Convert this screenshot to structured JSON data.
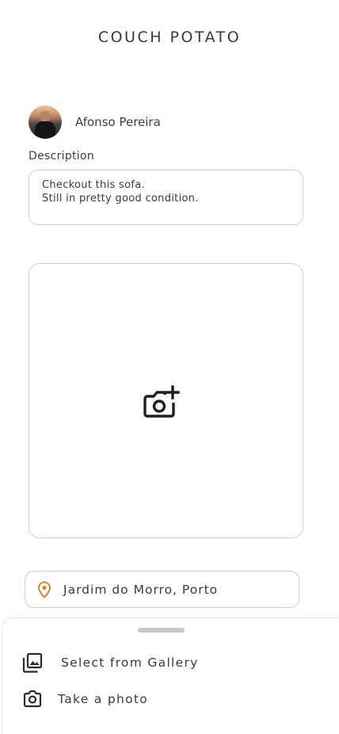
{
  "header": {
    "title": "COUCH POTATO"
  },
  "author": {
    "name": "Afonso Pereira"
  },
  "description": {
    "label": "Description",
    "value": "Checkout this sofa.\nStill in pretty good condition."
  },
  "photo": {
    "icon": "add-photo-icon"
  },
  "location": {
    "icon": "location-pin-icon",
    "value": "Jardim do Morro, Porto",
    "icon_color": "#d9822b"
  },
  "sheet": {
    "items": [
      {
        "icon": "gallery-icon",
        "label": "Select from Gallery"
      },
      {
        "icon": "camera-icon",
        "label": "Take a photo"
      }
    ]
  }
}
